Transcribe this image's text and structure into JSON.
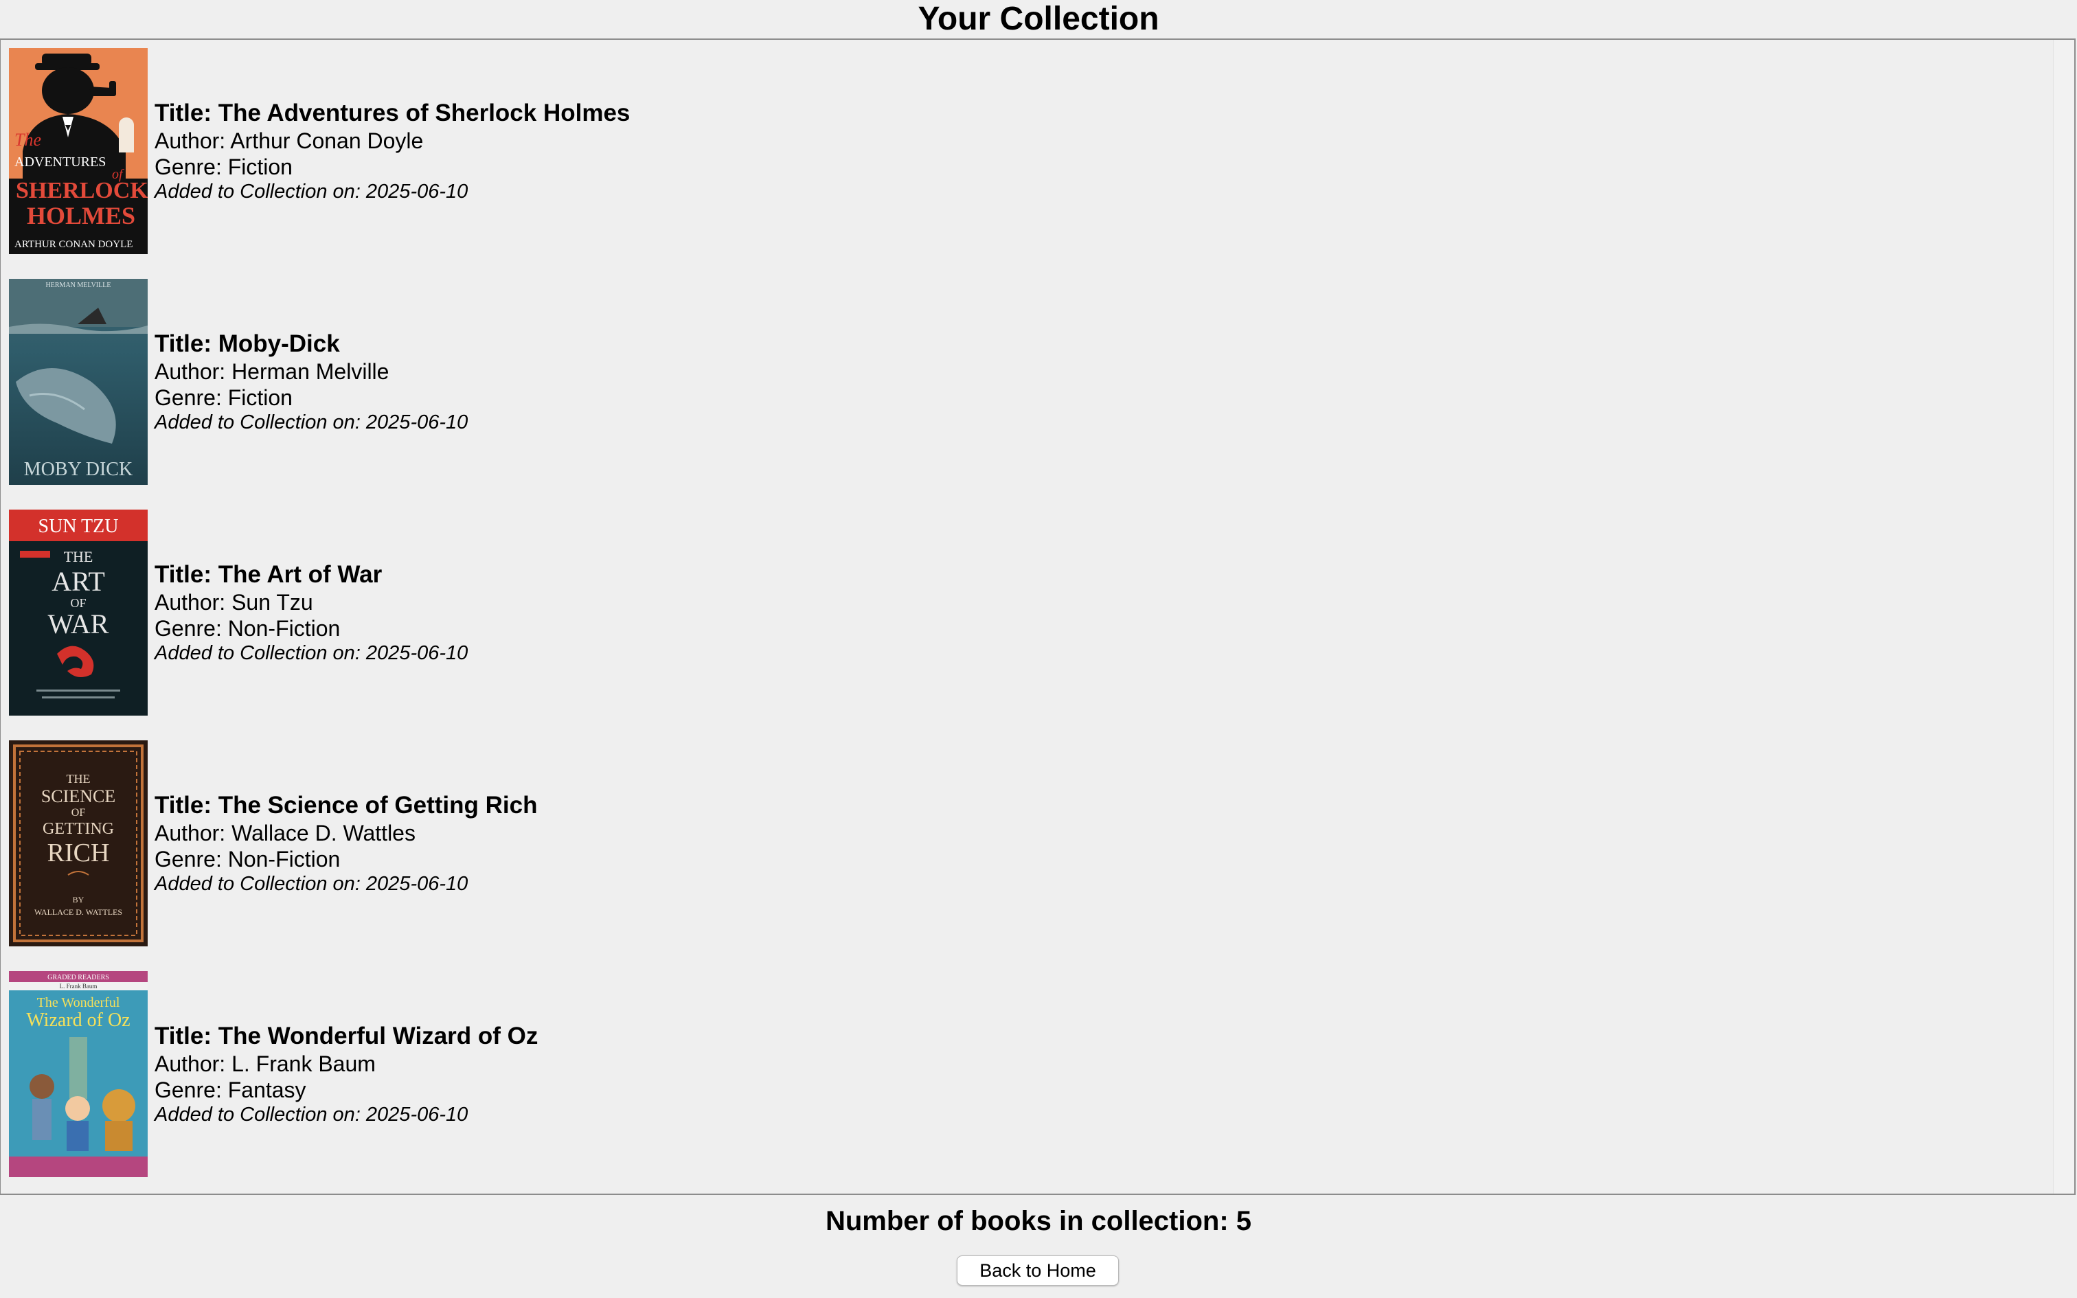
{
  "header": {
    "title": "Your Collection"
  },
  "labels": {
    "title_prefix": "Title: ",
    "author_prefix": "Author: ",
    "genre_prefix": "Genre: ",
    "added_prefix": "Added to Collection on: "
  },
  "books": [
    {
      "title": "Title: The Adventures of Sherlock Holmes",
      "author": "Author: Arthur Conan Doyle",
      "genre": "Genre: Fiction",
      "added": "Added to Collection on: 2025-06-10",
      "cover": {
        "icon": "sherlock-holmes-cover",
        "bg": "#e98550",
        "accent": "#d9362d",
        "text_lines": [
          "The",
          "ADVENTURES",
          "of",
          "SHERLOCK",
          "HOLMES",
          "ARTHUR CONAN DOYLE"
        ]
      }
    },
    {
      "title": "Title: Moby-Dick",
      "author": "Author: Herman Melville",
      "genre": "Genre: Fiction",
      "added": "Added to Collection on: 2025-06-10",
      "cover": {
        "icon": "moby-dick-cover",
        "bg": "#2f5c6a",
        "accent": "#8fb3bd",
        "text_lines": [
          "HERMAN MELVILLE",
          "MOBY DICK"
        ]
      }
    },
    {
      "title": "Title: The Art of War",
      "author": "Author: Sun Tzu",
      "genre": "Genre: Non-Fiction",
      "added": "Added to Collection on: 2025-06-10",
      "cover": {
        "icon": "art-of-war-cover",
        "bg": "#0f1f24",
        "accent": "#d3312b",
        "text_lines": [
          "SUN TZU",
          "THE",
          "ART",
          "OF",
          "WAR"
        ]
      }
    },
    {
      "title": "Title: The Science of Getting Rich",
      "author": "Author: Wallace D. Wattles",
      "genre": "Genre: Non-Fiction",
      "added": "Added to Collection on: 2025-06-10",
      "cover": {
        "icon": "science-of-getting-rich-cover",
        "bg": "#2a1a12",
        "accent": "#c2733a",
        "text_lines": [
          "THE",
          "SCIENCE",
          "OF",
          "GETTING",
          "RICH",
          "BY",
          "WALLACE D. WATTLES"
        ]
      }
    },
    {
      "title": "Title: The Wonderful Wizard of Oz",
      "author": "Author: L. Frank Baum",
      "genre": "Genre: Fantasy",
      "added": "Added to Collection on: 2025-06-10",
      "cover": {
        "icon": "wizard-of-oz-cover",
        "bg": "#3d9bb8",
        "accent": "#b5467f",
        "text_lines": [
          "GRADED READERS",
          "L. Frank Baum",
          "The Wonderful",
          "Wizard of Oz"
        ]
      }
    }
  ],
  "footer": {
    "count_text": "Number of books in collection: 5",
    "back_button_label": "Back to Home"
  }
}
